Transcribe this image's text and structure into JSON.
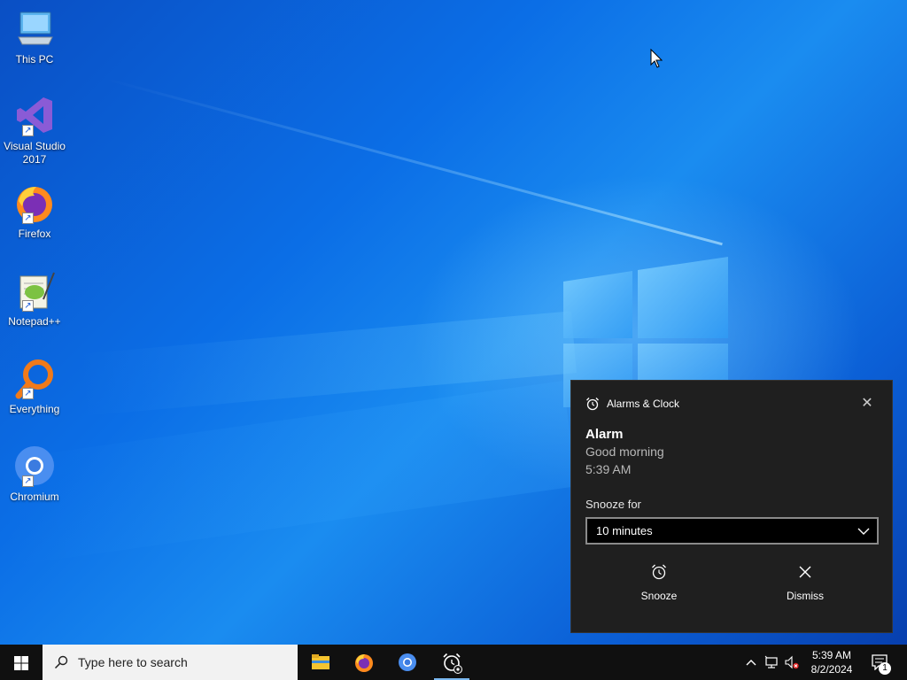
{
  "desktop": {
    "icons": [
      {
        "label": "This PC",
        "icon": "computer-icon"
      },
      {
        "label": "Visual Studio\n2017",
        "icon": "visual-studio-icon"
      },
      {
        "label": "Firefox",
        "icon": "firefox-icon"
      },
      {
        "label": "Notepad++",
        "icon": "notepadpp-icon"
      },
      {
        "label": "Everything",
        "icon": "everything-search-icon"
      },
      {
        "label": "Chromium",
        "icon": "chromium-icon"
      }
    ]
  },
  "notification": {
    "app_name": "Alarms & Clock",
    "title": "Alarm",
    "message": "Good morning",
    "time": "5:39 AM",
    "snooze_label": "Snooze for",
    "snooze_value": "10 minutes",
    "snooze_button": "Snooze",
    "dismiss_button": "Dismiss"
  },
  "taskbar": {
    "search_placeholder": "Type here to search",
    "apps": [
      "file-explorer-icon",
      "firefox-icon",
      "chromium-icon",
      "alarms-clock-icon"
    ],
    "clock_time": "5:39 AM",
    "clock_date": "8/2/2024",
    "notification_count": "1"
  },
  "colors": {
    "accent": "#0a64d6",
    "toast_bg": "#1f1f1f",
    "taskbar_bg": "#101010"
  }
}
